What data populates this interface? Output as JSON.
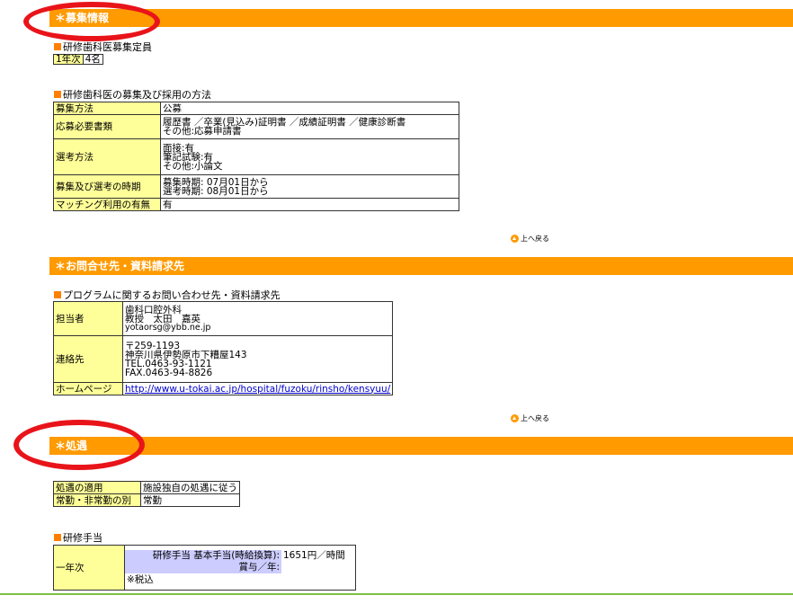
{
  "sections": {
    "recruit": {
      "title": "＊募集情報"
    },
    "contact": {
      "title": "＊お問合せ先・資料請求先"
    },
    "treatment": {
      "title": "＊処遇"
    }
  },
  "capacity": {
    "title": "研修歯科医募集定員",
    "rows": [
      {
        "label": "1年次",
        "value": "4名"
      }
    ]
  },
  "method": {
    "title": "研修歯科医の募集及び採用の方法",
    "rows": [
      {
        "label": "募集方法",
        "lines": [
          "公募"
        ]
      },
      {
        "label": "応募必要書類",
        "lines": [
          "履歴書 ／卒業(見込み)証明書 ／成績証明書 ／健康診断書",
          "その他:応募申請書"
        ]
      },
      {
        "label": "選考方法",
        "lines": [
          "面接:有",
          "筆記試験:有",
          "その他:小論文"
        ]
      },
      {
        "label": "募集及び選考の時期",
        "lines": [
          "募集時期: 07月01日から",
          "選考時期: 08月01日から"
        ]
      },
      {
        "label": "マッチング利用の有無",
        "lines": [
          "有"
        ]
      }
    ]
  },
  "back_to_top": "上へ戻る",
  "contact_info": {
    "title": "プログラムに関するお問い合わせ先・資料請求先",
    "person": {
      "label": "担当者",
      "lines": [
        "歯科口腔外科",
        "教授　太田　嘉英",
        "yotaorsg@ybb.ne.jp"
      ]
    },
    "address": {
      "label": "連絡先",
      "lines": [
        "〒259-1193",
        "神奈川県伊勢原市下糟屋143",
        "TEL.0463-93-1121",
        "FAX.0463-94-8826"
      ]
    },
    "homepage": {
      "label": "ホームページ",
      "url": "http://www.u-tokai.ac.jp/hospital/fuzoku/rinsho/kensyuu/"
    }
  },
  "treatment_info": {
    "rows": [
      {
        "label": "処遇の適用",
        "value": "施設独自の処遇に従う"
      },
      {
        "label": "常勤・非常勤の別",
        "value": "常勤"
      }
    ]
  },
  "allowance": {
    "title": "研修手当",
    "year_label": "一年次",
    "basic_label": "研修手当 基本手当(時給換算):",
    "basic_value": "1651円／時間",
    "bonus_label": "賞与／年:",
    "bonus_value": "",
    "tax_note": "※税込"
  },
  "colors": {
    "section_bar": "#ff9a00",
    "label_cell": "#ffff99",
    "highlight": "#ccccff",
    "annotation_ring": "#e8141a"
  }
}
